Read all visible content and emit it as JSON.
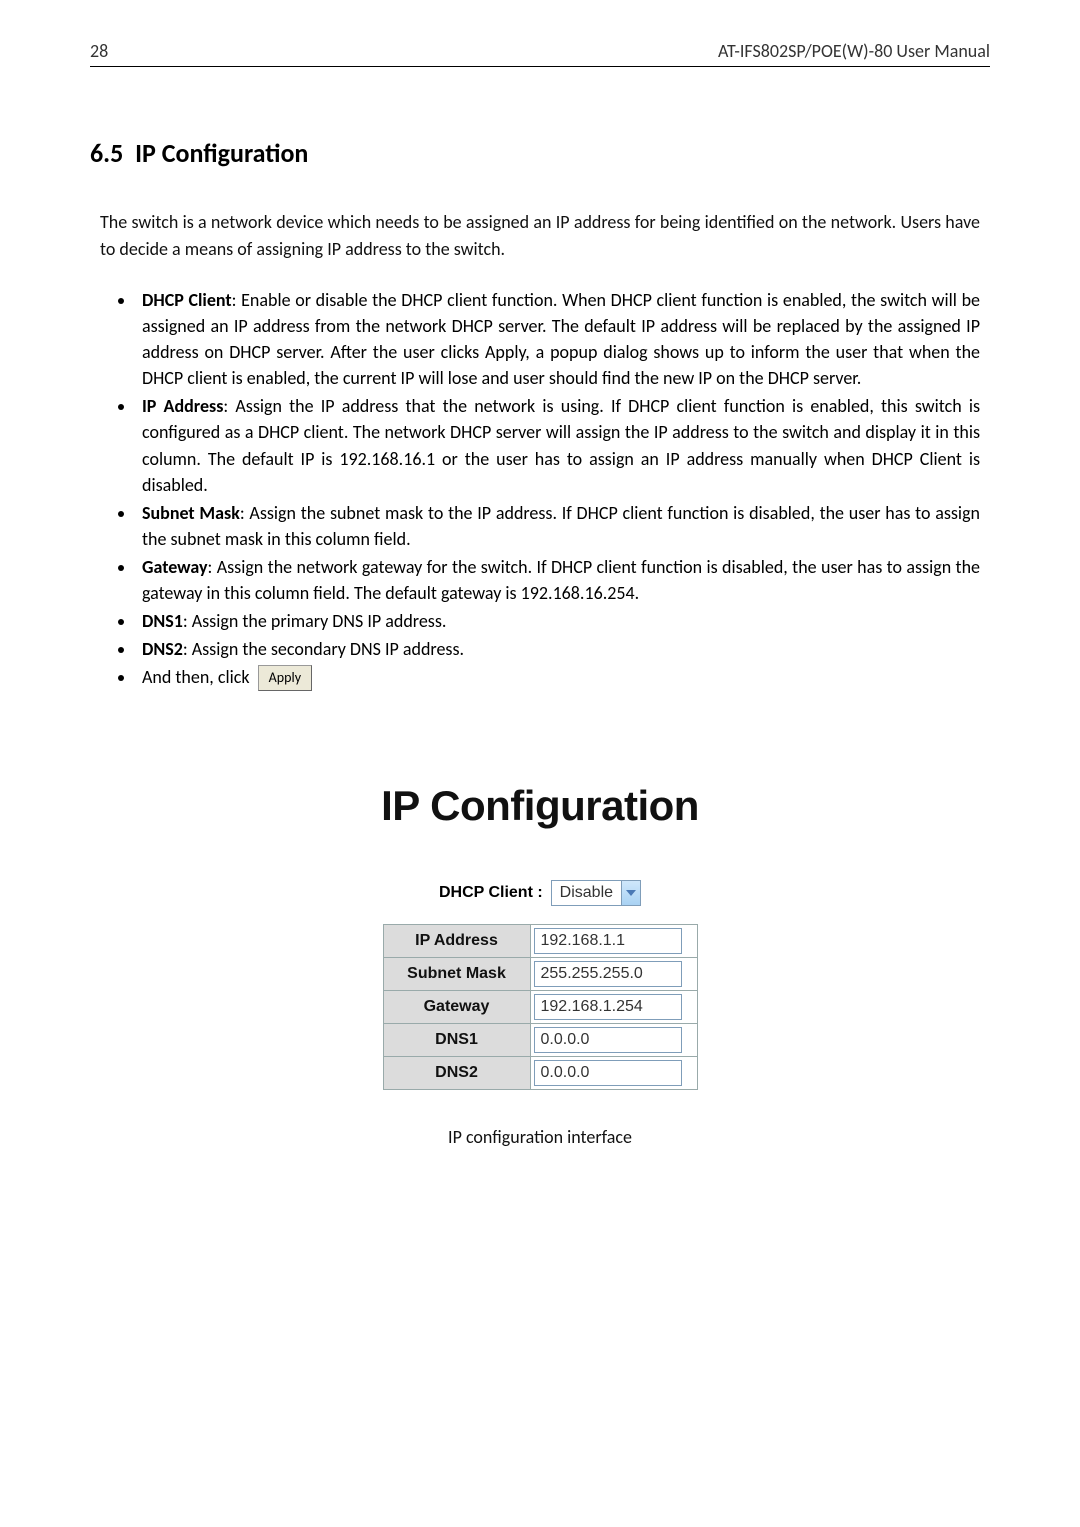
{
  "header": {
    "page_number": "28",
    "manual_title": "AT-IFS802SP/POE(W)-80 User Manual"
  },
  "section": {
    "number": "6.5",
    "title": "IP Configuration"
  },
  "intro": "The switch is a network device which needs to be assigned an IP address for being identified on the network. Users have to decide a means of assigning IP address to the switch.",
  "bullets": [
    {
      "term": "DHCP Client",
      "text": ": Enable or disable the DHCP client function. When DHCP client function is enabled, the switch will be assigned an IP address from the network DHCP server. The default IP address will be replaced by the assigned IP address on DHCP server. After the user clicks Apply, a popup dialog shows up to inform the user that when the DHCP client is enabled, the current IP will lose and user should find the new IP on the DHCP server."
    },
    {
      "term": "IP Address",
      "text": ": Assign the IP address that the network is using. If DHCP client function is enabled, this switch is configured as a DHCP client. The network DHCP server will assign the IP address to the switch and display it in this column. The default IP is 192.168.16.1 or the user has to assign an IP address manually when DHCP Client is disabled."
    },
    {
      "term": "Subnet Mask",
      "text": ": Assign the subnet mask to the IP address. If DHCP client function is disabled, the user has to assign the subnet mask in this column field."
    },
    {
      "term": "Gateway",
      "text": ": Assign the network gateway for the switch. If DHCP client function is disabled, the user has to assign the gateway in this column field. The default gateway is 192.168.16.254."
    },
    {
      "term": "DNS1",
      "text": ": Assign the primary DNS IP address."
    },
    {
      "term": "DNS2",
      "text": ": Assign the secondary DNS IP address."
    }
  ],
  "and_then_text": "And then, click",
  "apply_button": "Apply",
  "config_panel": {
    "title": "IP Configuration",
    "dhcp_label": "DHCP Client :",
    "dhcp_value": "Disable",
    "rows": [
      {
        "label": "IP Address",
        "value": "192.168.1.1"
      },
      {
        "label": "Subnet Mask",
        "value": "255.255.255.0"
      },
      {
        "label": "Gateway",
        "value": "192.168.1.254"
      },
      {
        "label": "DNS1",
        "value": "0.0.0.0"
      },
      {
        "label": "DNS2",
        "value": "0.0.0.0"
      }
    ],
    "caption": "IP configuration interface"
  }
}
